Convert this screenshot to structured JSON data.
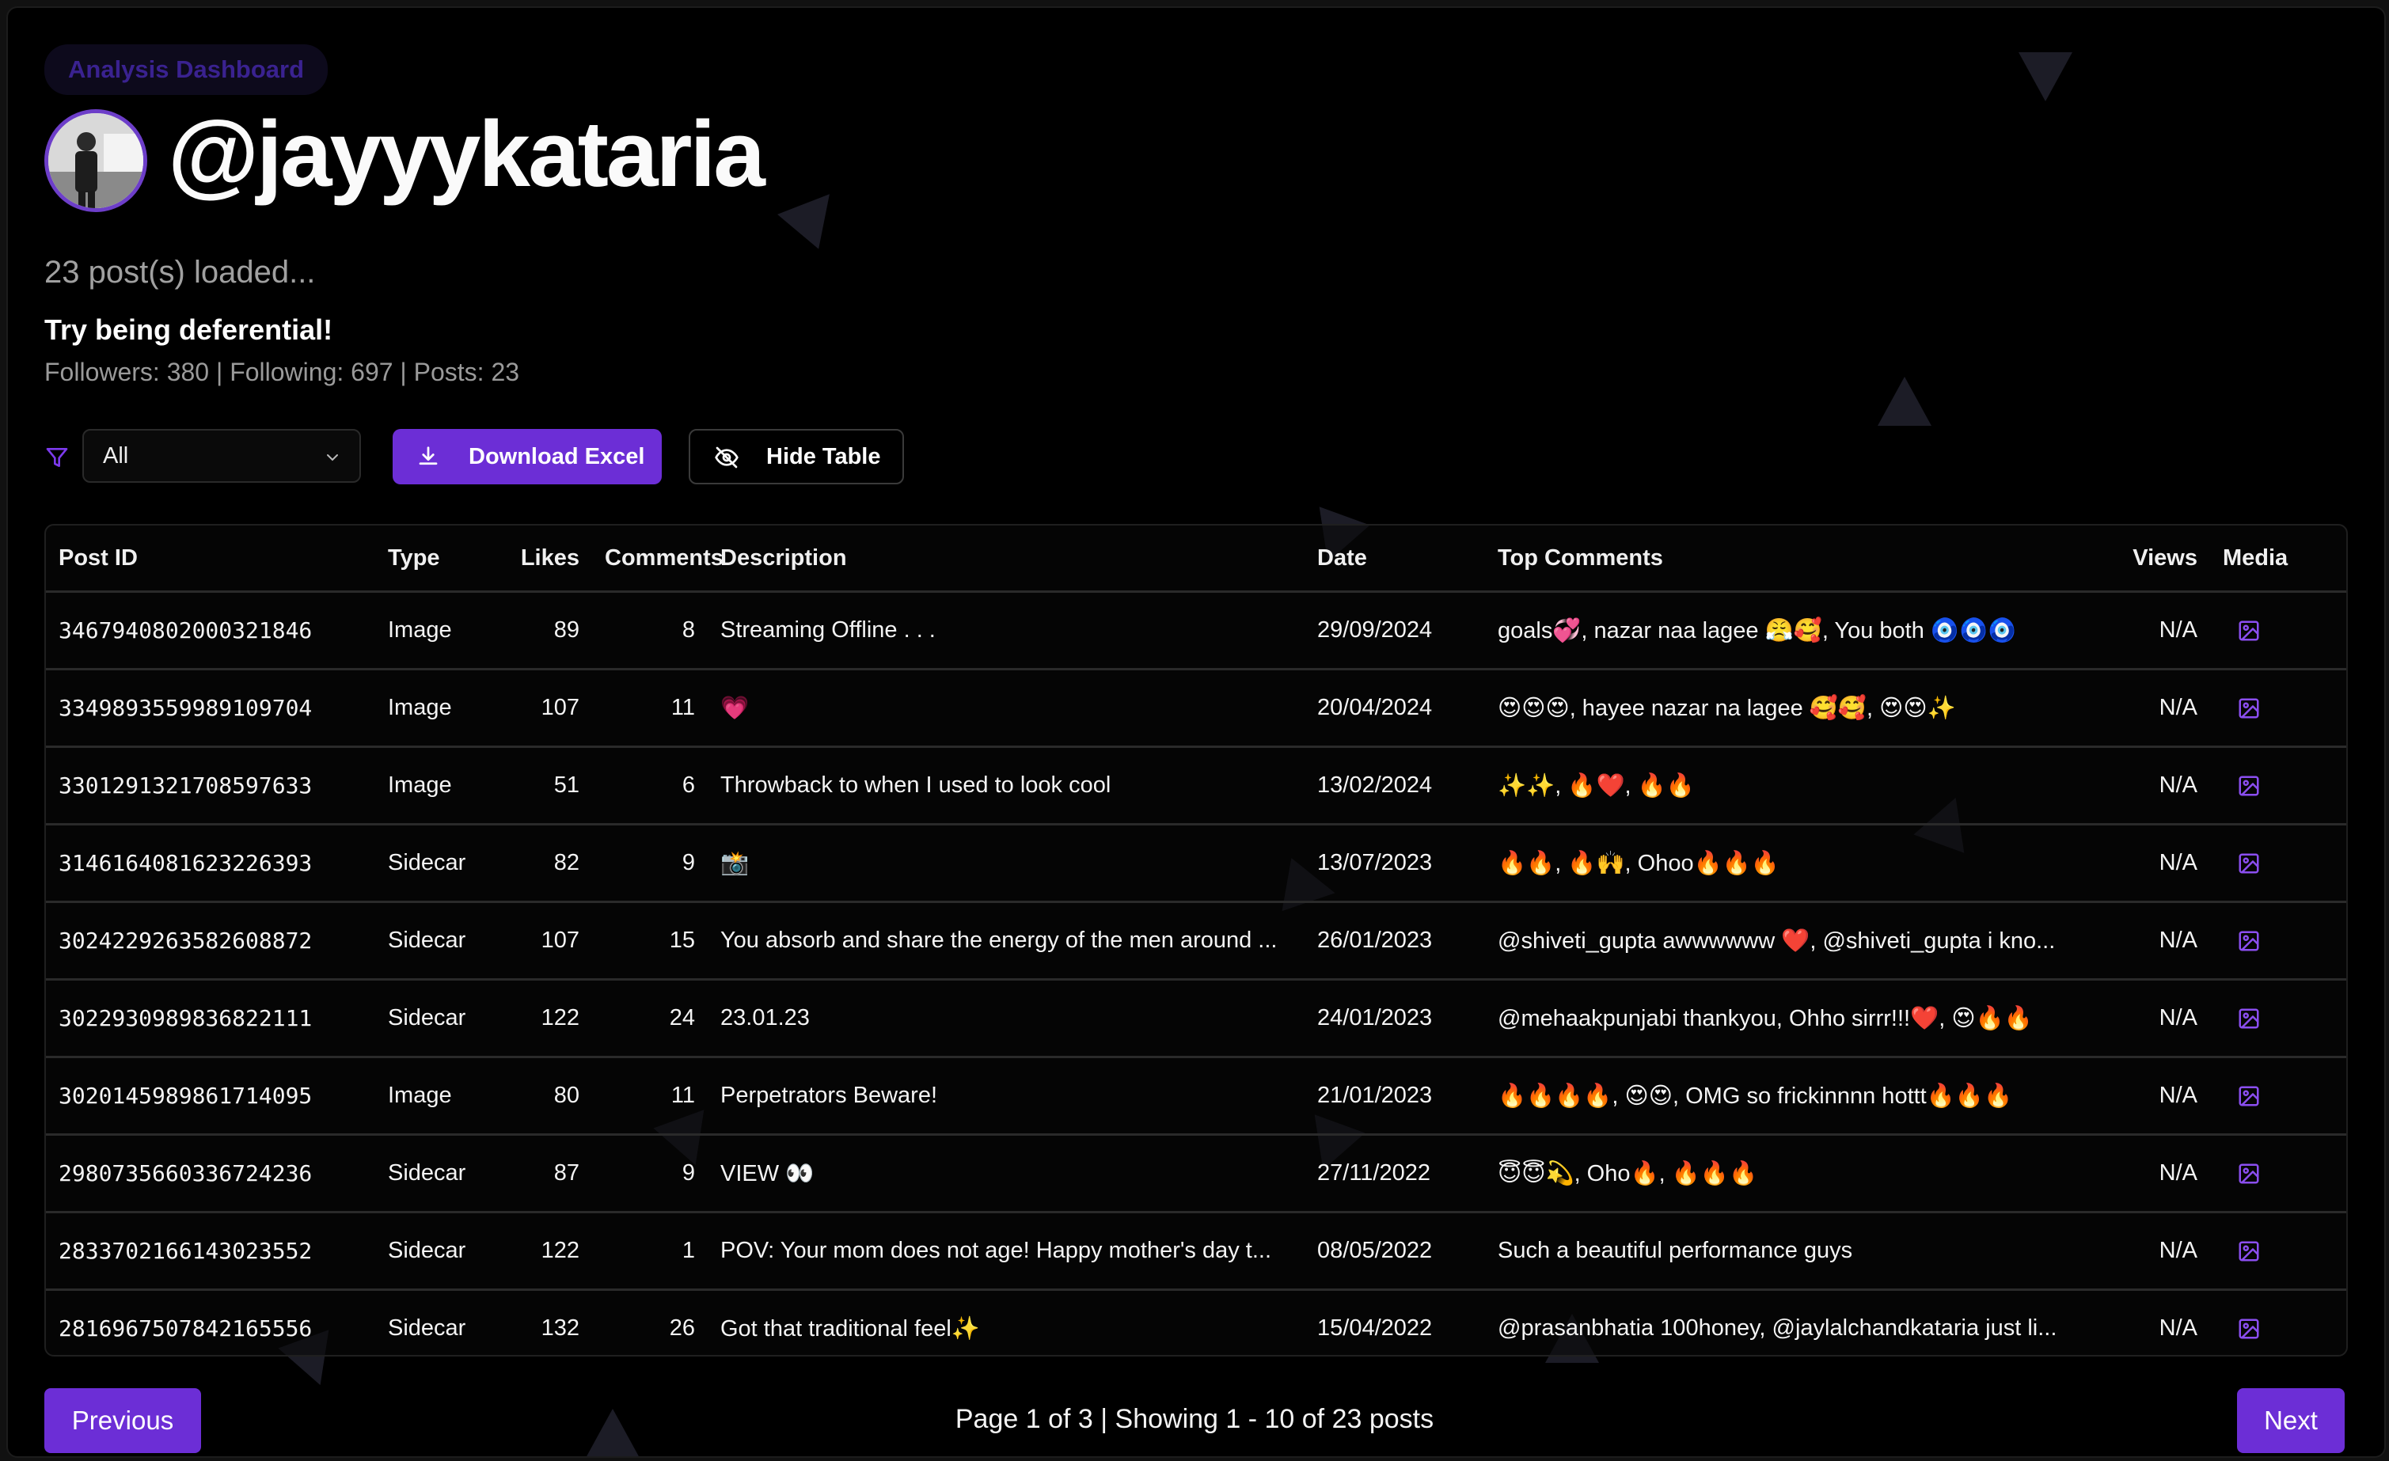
{
  "header": {
    "badge": "Analysis Dashboard",
    "username": "@jayyykataria",
    "loaded_text": "23 post(s) loaded...",
    "bio": "Try being deferential!",
    "stats": "Followers: 380 | Following: 697 | Posts: 23"
  },
  "controls": {
    "filter_icon": "filter-icon",
    "filter_value": "All",
    "download_label": "Download Excel",
    "hide_label": "Hide Table"
  },
  "table": {
    "columns": [
      "Post ID",
      "Type",
      "Likes",
      "Comments",
      "Description",
      "Date",
      "Top Comments",
      "Views",
      "Media"
    ],
    "rows": [
      {
        "id": "3467940802000321846",
        "type": "Image",
        "likes": "89",
        "comments": "8",
        "desc": "Streaming Offline . . .",
        "date": "29/09/2024",
        "top": "goals💞, nazar naa lagee 😤🥰, You both 🧿🧿🧿",
        "views": "N/A"
      },
      {
        "id": "3349893559989109704",
        "type": "Image",
        "likes": "107",
        "comments": "11",
        "desc": "💗",
        "date": "20/04/2024",
        "top": "😍😍😍, hayee nazar na lagee 🥰🥰, 😍😍✨",
        "views": "N/A"
      },
      {
        "id": "3301291321708597633",
        "type": "Image",
        "likes": "51",
        "comments": "6",
        "desc": "Throwback to when I used to look cool",
        "date": "13/02/2024",
        "top": "✨✨, 🔥❤️, 🔥🔥",
        "views": "N/A"
      },
      {
        "id": "3146164081623226393",
        "type": "Sidecar",
        "likes": "82",
        "comments": "9",
        "desc": "📸",
        "date": "13/07/2023",
        "top": "🔥🔥, 🔥🙌, Ohoo🔥🔥🔥",
        "views": "N/A"
      },
      {
        "id": "3024229263582608872",
        "type": "Sidecar",
        "likes": "107",
        "comments": "15",
        "desc": "You absorb and share the energy of the men around ...",
        "date": "26/01/2023",
        "top": "@shiveti_gupta awwwwww ❤️, @shiveti_gupta i kno...",
        "views": "N/A"
      },
      {
        "id": "3022930989836822111",
        "type": "Sidecar",
        "likes": "122",
        "comments": "24",
        "desc": "23.01.23",
        "date": "24/01/2023",
        "top": "@mehaakpunjabi thankyou, Ohho sirrr!!!❤️, 😍🔥🔥",
        "views": "N/A"
      },
      {
        "id": "3020145989861714095",
        "type": "Image",
        "likes": "80",
        "comments": "11",
        "desc": "Perpetrators Beware!",
        "date": "21/01/2023",
        "top": "🔥🔥🔥🔥, 😍😍, OMG so frickinnnn hottt🔥🔥🔥",
        "views": "N/A"
      },
      {
        "id": "2980735660336724236",
        "type": "Sidecar",
        "likes": "87",
        "comments": "9",
        "desc": "VIEW 👀",
        "date": "27/11/2022",
        "top": "😇😇💫, Oho🔥, 🔥🔥🔥",
        "views": "N/A"
      },
      {
        "id": "2833702166143023552",
        "type": "Sidecar",
        "likes": "122",
        "comments": "1",
        "desc": "POV: Your mom does not age! Happy mother's day t...",
        "date": "08/05/2022",
        "top": "Such a beautiful performance guys",
        "views": "N/A"
      },
      {
        "id": "2816967507842165556",
        "type": "Sidecar",
        "likes": "132",
        "comments": "26",
        "desc": "Got that traditional feel✨",
        "date": "15/04/2022",
        "top": "@prasanbhatia 100honey, @jaylalchandkataria just li...",
        "views": "N/A"
      }
    ]
  },
  "pagination": {
    "previous": "Previous",
    "info": "Page 1 of 3 | Showing 1 - 10 of 23 posts",
    "next": "Next"
  },
  "colors": {
    "accent": "#6c2ed6",
    "background": "#000000",
    "badge_text": "#3a2290"
  }
}
